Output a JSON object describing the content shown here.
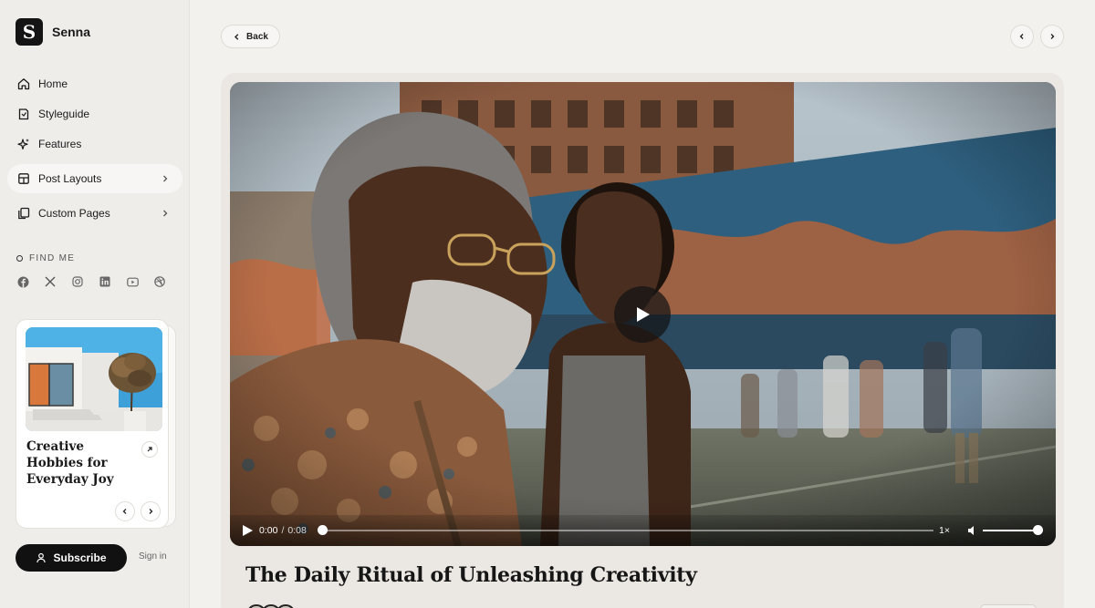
{
  "brand": {
    "name": "Senna",
    "logo_letter": "S"
  },
  "nav": [
    {
      "label": "Home",
      "icon": "home-icon"
    },
    {
      "label": "Styleguide",
      "icon": "book-icon"
    },
    {
      "label": "Features",
      "icon": "sparkle-icon"
    },
    {
      "label": "Post Layouts",
      "icon": "layout-icon",
      "has_submenu": true,
      "active": true
    },
    {
      "label": "Custom Pages",
      "icon": "pages-icon",
      "has_submenu": true
    }
  ],
  "find_me": {
    "label": "FIND ME",
    "socials": [
      "facebook-icon",
      "x-icon",
      "instagram-icon",
      "linkedin-icon",
      "youtube-icon",
      "dribbble-icon"
    ]
  },
  "featured_card": {
    "title": "Creative Hobbies for Everyday Joy",
    "image": "architecture-tree-image"
  },
  "account": {
    "subscribe_label": "Subscribe",
    "sign_in_label": "Sign in"
  },
  "top_bar": {
    "back_label": "Back"
  },
  "video": {
    "current_time": "0:00",
    "separator": "/",
    "duration": "0:08",
    "speed": "1×",
    "progress": 0,
    "volume": 1.0
  },
  "post": {
    "title": "The Daily Ritual of Unleashing Creativity"
  },
  "colors": {
    "background": "#f3f1ee",
    "sidebar": "#efedea",
    "accent": "#111111"
  }
}
